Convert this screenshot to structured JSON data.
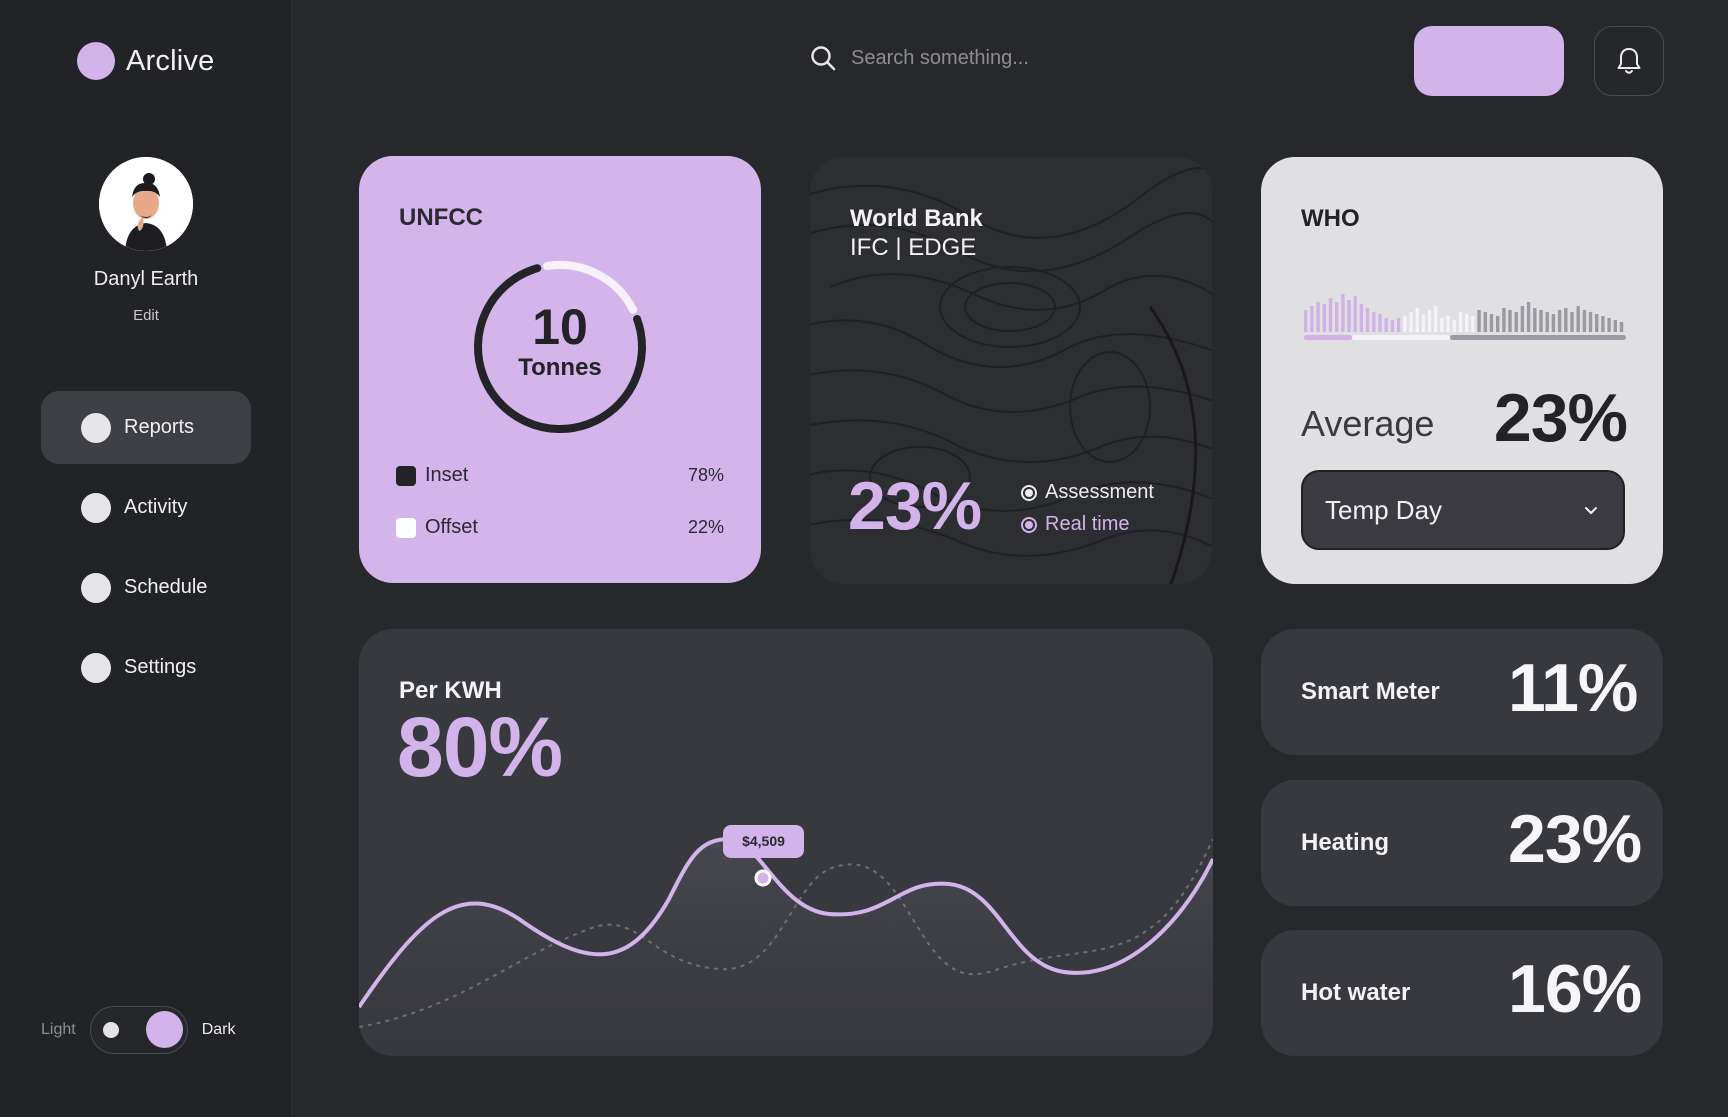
{
  "app": {
    "name": "Arclive"
  },
  "user": {
    "name": "Danyl Earth",
    "edit_label": "Edit"
  },
  "nav": {
    "items": [
      {
        "label": "Reports"
      },
      {
        "label": "Activity"
      },
      {
        "label": "Schedule"
      },
      {
        "label": "Settings"
      }
    ]
  },
  "theme": {
    "light_label": "Light",
    "dark_label": "Dark"
  },
  "search": {
    "placeholder": "Search something..."
  },
  "colors": {
    "accent": "#d2b3ea",
    "background": "#27282c",
    "card_dark": "#38393f",
    "card_light": "#e0e0e2"
  },
  "unfcc": {
    "title": "UNFCC",
    "value": "10",
    "unit": "Tonnes",
    "progress_fraction": 0.78,
    "legend": [
      {
        "label": "Inset",
        "pct": "78%"
      },
      {
        "label": "Offset",
        "pct": "22%"
      }
    ]
  },
  "worldbank": {
    "title": "World Bank",
    "subtitle": "IFC | EDGE",
    "value": "23%",
    "options": [
      {
        "label": "Assessment"
      },
      {
        "label": "Real time"
      }
    ]
  },
  "who": {
    "title": "WHO",
    "avg_label": "Average",
    "avg_value": "23%",
    "select_value": "Temp Day"
  },
  "kwh": {
    "title": "Per KWH",
    "value": "80%",
    "tooltip": "$4,509"
  },
  "stats": [
    {
      "label": "Smart Meter",
      "value": "11%"
    },
    {
      "label": "Heating",
      "value": "23%"
    },
    {
      "label": "Hot water",
      "value": "16%"
    }
  ]
}
